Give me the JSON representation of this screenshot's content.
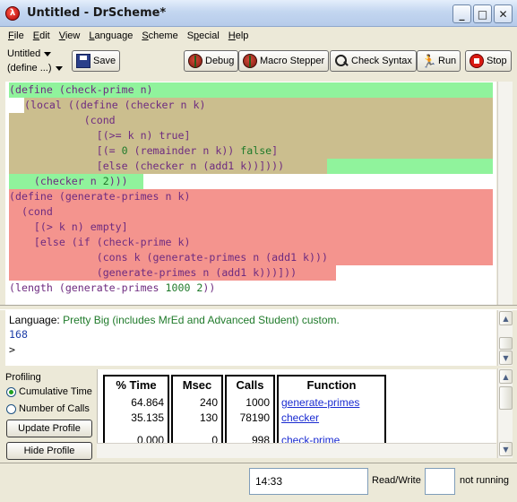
{
  "window": {
    "title": "Untitled - DrScheme*",
    "controls": [
      "minimize",
      "maximize",
      "close"
    ]
  },
  "menu": [
    {
      "label": "File",
      "key": "F",
      "rest": "ile"
    },
    {
      "label": "Edit",
      "key": "E",
      "rest": "dit"
    },
    {
      "label": "View",
      "key": "V",
      "rest": "iew"
    },
    {
      "label": "Language",
      "key": "L",
      "rest": "anguage"
    },
    {
      "label": "Scheme",
      "key": "S",
      "rest": "cheme"
    },
    {
      "label": "Special",
      "key": "p",
      "pre": "S",
      "rest": "ecial"
    },
    {
      "label": "Help",
      "key": "H",
      "rest": "elp"
    }
  ],
  "toolbar": {
    "file_name": "Untitled",
    "define_menu": "(define ...)",
    "save": "Save",
    "debug": "Debug",
    "macro_stepper": "Macro Stepper",
    "check_syntax": "Check Syntax",
    "run": "Run",
    "stop": "Stop"
  },
  "editor": {
    "lines": [
      "(define (check-prime n)",
      "  (local ((define (checker n k)",
      "            (cond",
      "              [(>= k n) true]",
      "              [(= 0 (remainder n k)) false]",
      "              [else (checker n (add1 k))])))",
      "    (checker n 2)))",
      "(define (generate-primes n k)",
      "  (cond",
      "    [(> k n) empty]",
      "    [else (if (check-prime k)",
      "              (cons k (generate-primes n (add1 k)))",
      "              (generate-primes n (add1 k)))]))",
      "(length (generate-primes 1000 2))"
    ]
  },
  "interactions": {
    "language_prefix": "Language: ",
    "language_value": "Pretty Big (includes MrEd and Advanced Student) custom.",
    "result": "168",
    "prompt": ">"
  },
  "profile": {
    "label": "Profiling",
    "modes": [
      "Cumulative Time",
      "Number of Calls"
    ],
    "selected_mode": "Cumulative Time",
    "update_button": "Update Profile",
    "hide_button": "Hide Profile",
    "columns": [
      "% Time",
      "Msec",
      "Calls",
      "Function"
    ],
    "rows": [
      {
        "time": "64.864",
        "msec": "240",
        "calls": "1000",
        "function": "generate-primes"
      },
      {
        "time": "35.135",
        "msec": "130",
        "calls": "78190",
        "function": "checker"
      },
      {
        "time": "0.000",
        "msec": "0",
        "calls": "998",
        "function": "check-prime"
      }
    ]
  },
  "status": {
    "time": "14:33",
    "mode": "Read/Write",
    "state": "not running"
  },
  "colors": {
    "highlight_green": "#90f39c",
    "highlight_khaki": "#cbbe8e",
    "highlight_red": "#f4948e",
    "code_text": "#6e2b80",
    "number_text": "#1f7a2a"
  }
}
